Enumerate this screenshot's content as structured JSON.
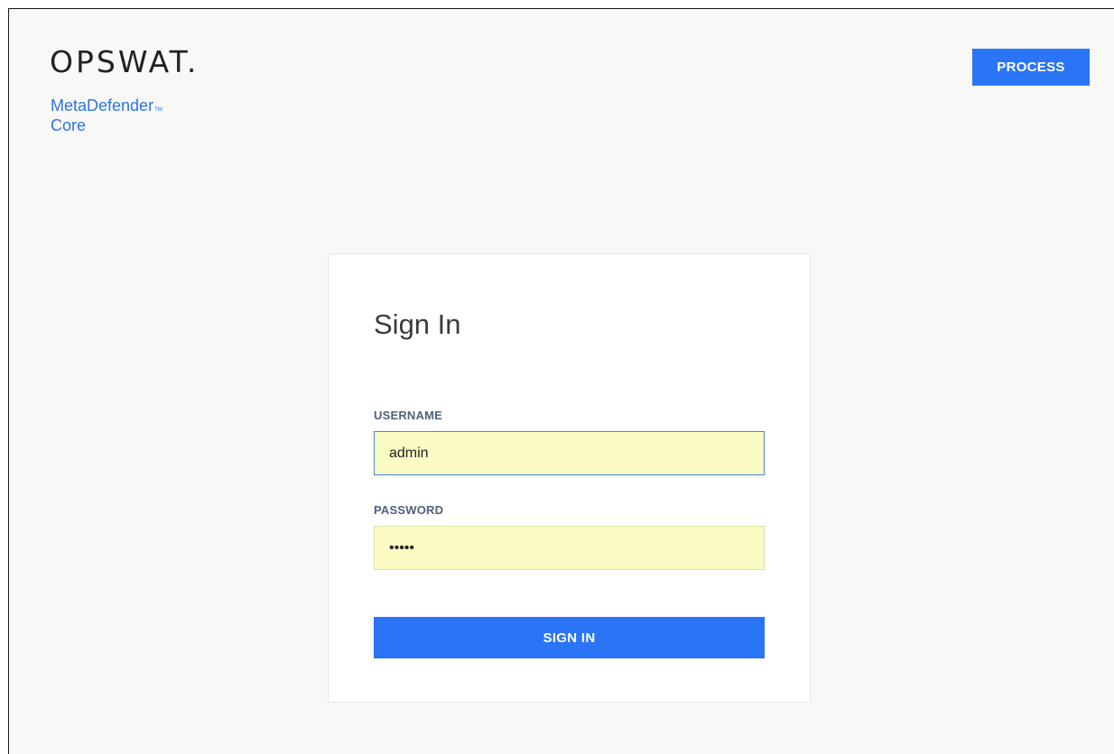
{
  "header": {
    "brand_name": "OPSWAT.",
    "product_name": "MetaDefender",
    "product_tm": "TM",
    "product_edition": "Core",
    "process_label": "PROCESS"
  },
  "signin": {
    "title": "Sign In",
    "username_label": "USERNAME",
    "username_value": "admin",
    "password_label": "PASSWORD",
    "password_value": "•••••",
    "submit_label": "SIGN IN"
  },
  "colors": {
    "accent": "#2a74f6",
    "brand_blue": "#2a74e8",
    "autofill_background": "#fafcc4",
    "page_background": "#f8f8f6"
  }
}
